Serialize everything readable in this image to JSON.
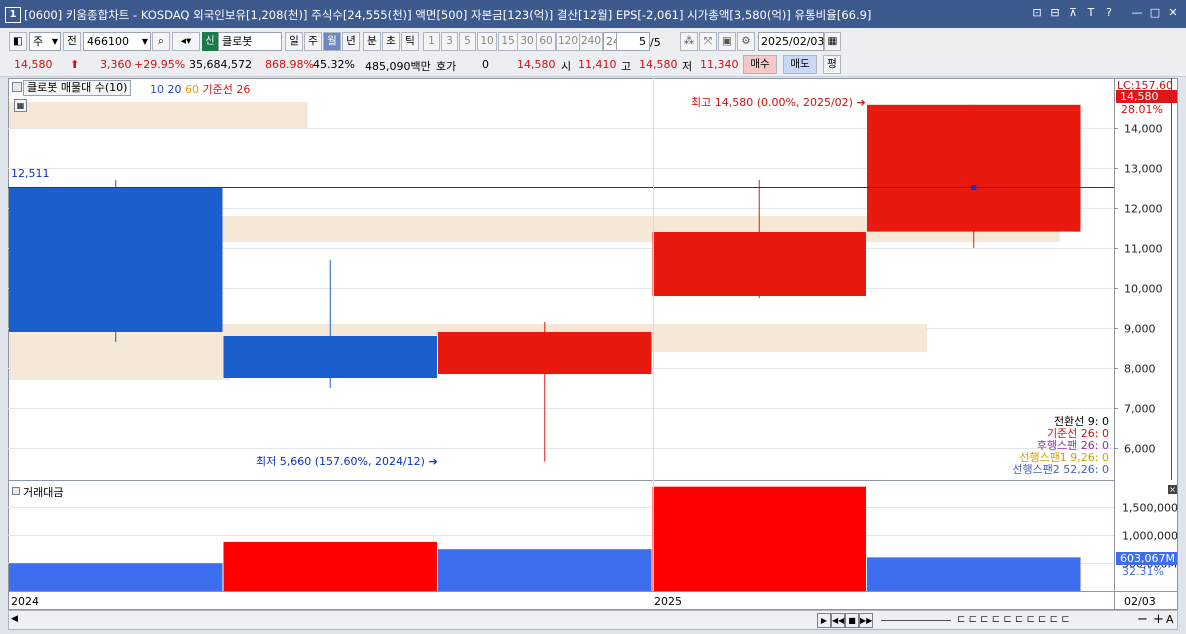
{
  "window": {
    "badge": "1",
    "title": "[0600] 키움종합차트 - KOSDAQ 외국인보유[1,208(천)] 주식수[24,555(천)] 액면[500] 자본금[123(억)] 결산[12월] EPS[-2,061] 시가총액[3,580(억)] 유통비율[66.9]",
    "buttons": [
      "⊡",
      "⊟",
      "⊼",
      "T",
      "?",
      "—",
      "□",
      "✕"
    ]
  },
  "toolbar": {
    "market": "주",
    "scope": "전",
    "code": "466100",
    "badge_new": "신",
    "stock_name": "클로봇",
    "periods": [
      {
        "label": "일",
        "selected": false
      },
      {
        "label": "주",
        "selected": false
      },
      {
        "label": "월",
        "selected": true
      },
      {
        "label": "년",
        "selected": false
      },
      {
        "label": "분",
        "selected": false
      },
      {
        "label": "초",
        "selected": false
      },
      {
        "label": "틱",
        "selected": false
      }
    ],
    "intervals": [
      "1",
      "3",
      "5",
      "10",
      "15",
      "30",
      "60",
      "120",
      "240",
      "240"
    ],
    "count_value": "5",
    "count_total": "/5",
    "date": "2025/02/03"
  },
  "quote": {
    "price": "14,580",
    "change": "3,360",
    "change_pct": "+29.95%",
    "volume": "35,684,572",
    "vol_ratio": "868.98%",
    "turnover": "45.32%",
    "amount": "485,090백만",
    "hoga_label": "호가",
    "hoga_value": "0",
    "last": "14,580",
    "open_label": "시",
    "open": "11,410",
    "high_label": "고",
    "high": "14,580",
    "low_label": "저",
    "low": "11,340",
    "buy": "매수",
    "sell": "매도",
    "eval": "평"
  },
  "price_panel": {
    "legend_name": "클로봇 매물대 수(10)",
    "legend_ma": [
      {
        "label": "10",
        "color": "#3050d0"
      },
      {
        "label": "20",
        "color": "#2040a0"
      },
      {
        "label": "60",
        "color": "#e0a000"
      },
      {
        "label": "기준선 26",
        "color": "#d01010"
      }
    ],
    "ref_line_label": "12,511",
    "max_label": "최고 14,580 (0.00%, 2025/02)",
    "min_label": "최저 5,660 (157.60%, 2024/12)",
    "lc_label": "LC:157.60",
    "last_badge": "14,580",
    "last_pct": "28.01%",
    "ichimoku": [
      {
        "label": "전환선 9: 0",
        "color": "#000000"
      },
      {
        "label": "기준선 26: 0",
        "color": "#d01010"
      },
      {
        "label": "후행스팬 26: 0",
        "color": "#9030b0"
      },
      {
        "label": "선행스팬1 9,26: 0",
        "color": "#d0a000"
      },
      {
        "label": "선행스팬2 52,26: 0",
        "color": "#4060c0"
      }
    ]
  },
  "volume_panel": {
    "title": "거래대금",
    "last_badge": "603,067M",
    "last_pct": "32.31%"
  },
  "x_axis": {
    "left_label": "2024",
    "mid_label": "2025",
    "right_label": "02/03"
  },
  "colors": {
    "up": "#e8190f",
    "down": "#1a5fcc",
    "vol_up": "#ff0000",
    "vol_down": "#3d6ef0",
    "profile": "#f5e8d7"
  },
  "chart_data": [
    {
      "type": "candlestick",
      "y_ticks": [
        6000,
        7000,
        8000,
        9000,
        10000,
        11000,
        12000,
        13000,
        14000
      ],
      "ylim": [
        5200,
        15250
      ],
      "candles": [
        {
          "open": 12500,
          "high": 12700,
          "low": 8650,
          "close": 8900
        },
        {
          "open": 8800,
          "high": 10700,
          "low": 7500,
          "close": 7750
        },
        {
          "open": 7850,
          "high": 9150,
          "low": 5660,
          "close": 8900
        },
        {
          "open": 9800,
          "high": 12700,
          "low": 9750,
          "close": 11400
        },
        {
          "open": 11410,
          "high": 14580,
          "low": 11000,
          "close": 14580
        }
      ],
      "reference_line": 12511,
      "volume_profile": [
        {
          "from": 14000,
          "to": 14650,
          "width": 0.27
        },
        {
          "from": 11150,
          "to": 11800,
          "width": 0.95
        },
        {
          "from": 8400,
          "to": 9100,
          "width": 0.83
        },
        {
          "from": 7700,
          "to": 8400,
          "width": 0.2
        }
      ]
    },
    {
      "type": "bar",
      "title": "거래대금",
      "y_ticks": [
        500000,
        1000000,
        1500000
      ],
      "y_tick_labels": [
        "500,000M",
        "1,000,000M",
        "1,500,000M"
      ],
      "ylim": [
        0,
        1900000
      ],
      "values": [
        498000,
        880000,
        750000,
        1870000,
        603067
      ],
      "direction": [
        "down",
        "up",
        "down",
        "up",
        "down"
      ]
    }
  ]
}
